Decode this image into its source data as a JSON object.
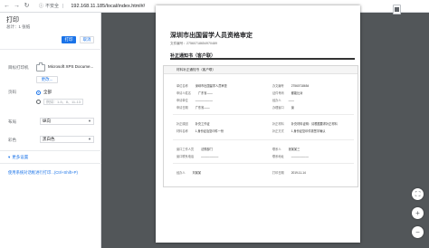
{
  "address_bar": {
    "back_icon": "arrow-left-icon",
    "forward_icon": "arrow-right-icon",
    "reload_icon": "reload-icon",
    "security": "不安全",
    "url_host": "192.168.11.185",
    "url_path": "/local/index.html#/"
  },
  "print_panel": {
    "title": "打印",
    "sheet_count": "总计：1 张纸",
    "print_button": "打印",
    "cancel_button": "取消",
    "destination_label": "目标打印机",
    "destination_value": "Microsoft XPS Docume...",
    "change_button": "更改...",
    "pages_label": "页码",
    "pages_all": "全部",
    "pages_custom_placeholder": "例如：1-5、8、11-13",
    "layout_label": "布局",
    "layout_value": "纵向",
    "color_label": "彩色",
    "color_value": "黑白色",
    "more_settings": "更多设置",
    "system_dialog": "使用系统对话框进行打印...(Ctrl+Shift+P)"
  },
  "document": {
    "title": "深圳市出国留学人员资格审定",
    "number": "文件编号：27560718654970489",
    "section_heading": "补正通知书（客户联）",
    "card_header": "材料补正通知书（客户联）",
    "group1": [
      [
        "单位名称",
        "深圳市出国留学人员审查"
      ],
      [
        "办文编号",
        "27560718654"
      ],
      [
        "申请人姓名",
        "广东省——"
      ],
      [
        "证件号码",
        "都能比对"
      ],
      [
        "申请单位",
        "——————"
      ],
      [
        "经办人",
        "——"
      ],
      [
        "申请日期",
        "广东省——"
      ],
      [
        "办理窗口",
        "窗"
      ]
    ],
    "group2": [
      [
        "补正原因",
        "补充工作证"
      ],
      [
        "补正材料",
        "补充材料证明：请根据要求补正材料"
      ],
      [
        "材料名称",
        "1.身份证及复印件一份"
      ],
      [
        "补正方式",
        "1.身份证复印件需签字确认"
      ]
    ],
    "group3": [
      [
        "窗口工作人员",
        "法规部门"
      ],
      [
        "联系人",
        "张某某三"
      ],
      [
        "窗口联系电话",
        "——————"
      ],
      [
        "联系地址",
        "——————"
      ]
    ],
    "group4": [
      [
        "经办人",
        "刘某某"
      ],
      [
        "打印日期",
        "2019-11-14"
      ]
    ]
  },
  "preview_tools": {
    "fit_icon": "fit-page-icon",
    "zoom_in_icon": "zoom-in-icon",
    "zoom_out_icon": "zoom-out-icon"
  }
}
